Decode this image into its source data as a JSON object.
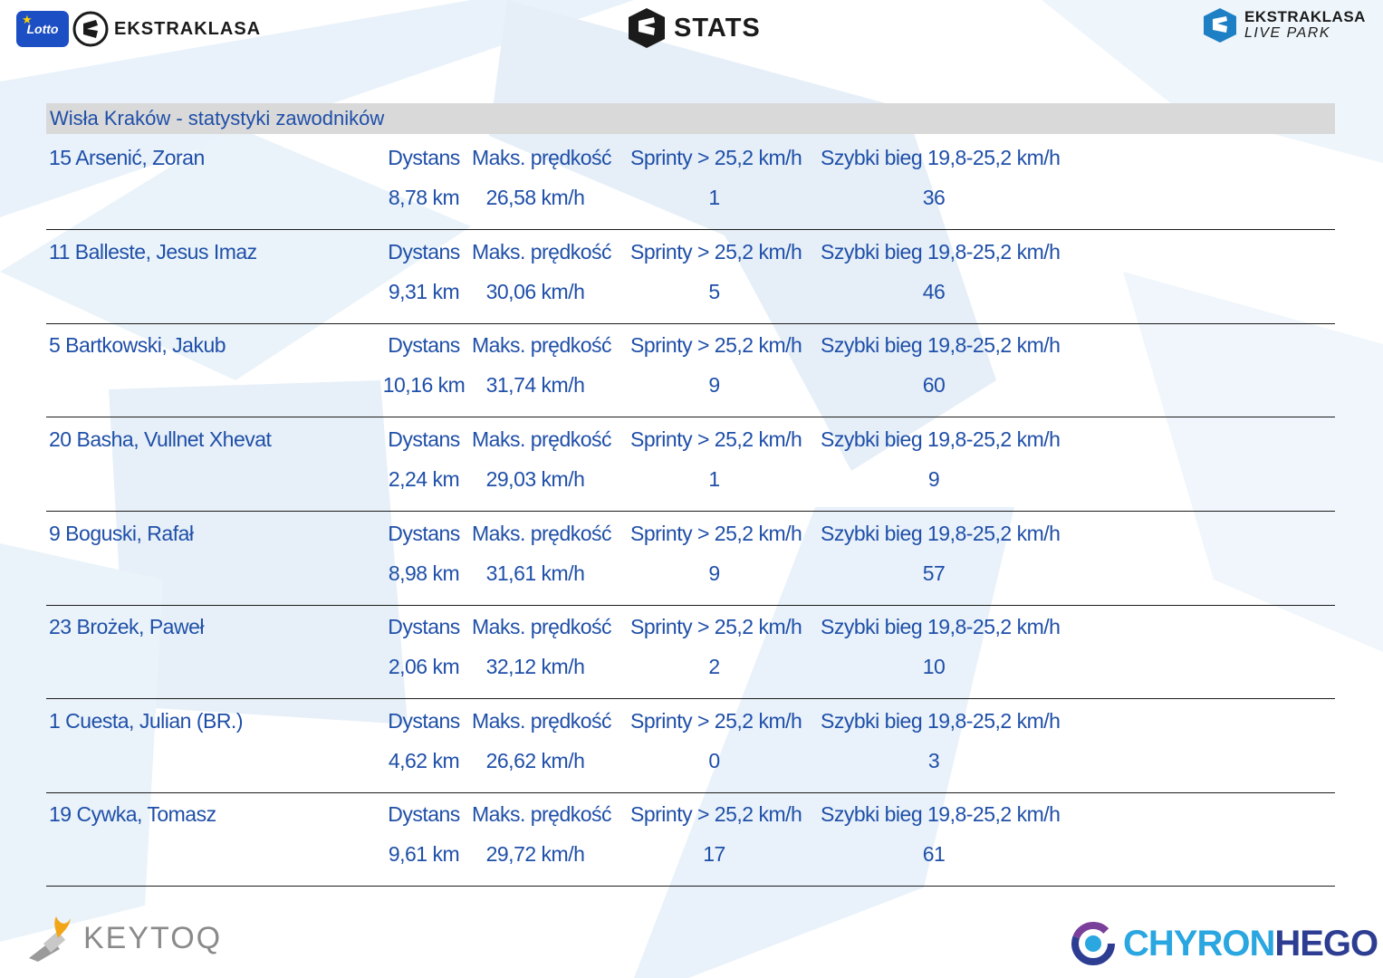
{
  "header": {
    "left_badge": "Lotto",
    "left_brand": "EKSTRAKLASA",
    "center_brand": "STATS",
    "right_brand_line1": "EKSTRAKLASA",
    "right_brand_line2": "LIVE PARK"
  },
  "table": {
    "title": "Wisła Kraków - statystyki zawodników",
    "labels": {
      "distance": "Dystans",
      "max_speed": "Maks. prędkość",
      "sprints": "Sprinty > 25,2 km/h",
      "fast_run": "Szybki bieg 19,8-25,2 km/h"
    },
    "players": [
      {
        "name": "15  Arsenić, Zoran",
        "distance": "8,78 km",
        "max_speed": "26,58 km/h",
        "sprints": "1",
        "fast_run": "36"
      },
      {
        "name": "11  Balleste, Jesus Imaz",
        "distance": "9,31 km",
        "max_speed": "30,06 km/h",
        "sprints": "5",
        "fast_run": "46"
      },
      {
        "name": "5  Bartkowski, Jakub",
        "distance": "10,16 km",
        "max_speed": "31,74 km/h",
        "sprints": "9",
        "fast_run": "60"
      },
      {
        "name": "20  Basha, Vullnet Xhevat",
        "distance": "2,24 km",
        "max_speed": "29,03 km/h",
        "sprints": "1",
        "fast_run": "9"
      },
      {
        "name": "9  Boguski, Rafał",
        "distance": "8,98 km",
        "max_speed": "31,61 km/h",
        "sprints": "9",
        "fast_run": "57"
      },
      {
        "name": "23  Brożek, Paweł",
        "distance": "2,06 km",
        "max_speed": "32,12 km/h",
        "sprints": "2",
        "fast_run": "10"
      },
      {
        "name": "1  Cuesta, Julian (BR.)",
        "distance": "4,62 km",
        "max_speed": "26,62 km/h",
        "sprints": "0",
        "fast_run": "3"
      },
      {
        "name": "19  Cywka, Tomasz",
        "distance": "9,61 km",
        "max_speed": "29,72 km/h",
        "sprints": "17",
        "fast_run": "61"
      }
    ]
  },
  "footer": {
    "left_brand": "KEYTOQ",
    "right_brand_a": "CHYRON",
    "right_brand_b": "HEGO"
  },
  "colors": {
    "text": "#1f4fa8",
    "title_bar": "#d9d9d9",
    "watermark": "#e6f0f8"
  }
}
